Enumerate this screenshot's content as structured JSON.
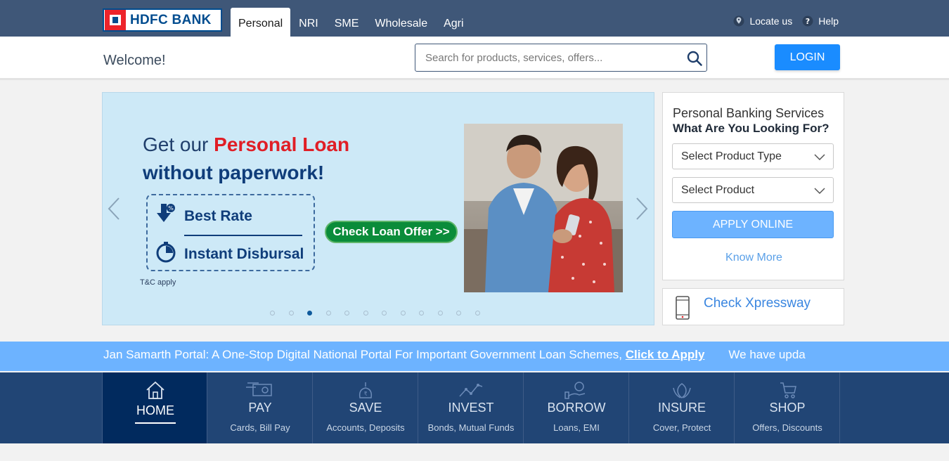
{
  "brand": {
    "logo_text": "HDFC BANK"
  },
  "topnav": {
    "tabs": [
      {
        "label": "Personal",
        "active": true
      },
      {
        "label": "NRI"
      },
      {
        "label": "SME"
      },
      {
        "label": "Wholesale"
      },
      {
        "label": "Agri"
      }
    ],
    "locate_label": "Locate us",
    "help_label": "Help"
  },
  "header": {
    "welcome": "Welcome!",
    "search_placeholder": "Search for products, services, offers...",
    "login_label": "LOGIN"
  },
  "banner": {
    "headline_prefix": "Get our ",
    "headline_highlight": "Personal Loan",
    "headline_line2": "without paperwork!",
    "feature_1": "Best Rate",
    "feature_2": "Instant Disbursal",
    "cta_label": "Check Loan Offer >>",
    "tnc": "T&C apply",
    "slide_count": 12,
    "active_slide": 3
  },
  "services": {
    "title": "Personal Banking Services",
    "subtitle": "What Are You Looking For?",
    "select_type": "Select Product Type",
    "select_product": "Select Product",
    "apply_label": "APPLY ONLINE",
    "know_more": "Know More"
  },
  "xpressway": {
    "label": "Check Xpressway"
  },
  "ticker": {
    "text": "Jan Samarth Portal: A One-Stop Digital National Portal For Important Government Loan Schemes, ",
    "link": "Click to Apply",
    "next_text": "We have upda"
  },
  "bottomnav": {
    "items": [
      {
        "title": "HOME",
        "sub": "",
        "icon": "home-icon",
        "active": true
      },
      {
        "title": "PAY",
        "sub": "Cards, Bill Pay",
        "icon": "pay-icon"
      },
      {
        "title": "SAVE",
        "sub": "Accounts, Deposits",
        "icon": "save-icon"
      },
      {
        "title": "INVEST",
        "sub": "Bonds, Mutual Funds",
        "icon": "invest-icon"
      },
      {
        "title": "BORROW",
        "sub": "Loans, EMI",
        "icon": "borrow-icon"
      },
      {
        "title": "INSURE",
        "sub": "Cover, Protect",
        "icon": "insure-icon"
      },
      {
        "title": "SHOP",
        "sub": "Offers, Discounts",
        "icon": "shop-icon"
      }
    ]
  },
  "colors": {
    "topbar": "#3f5778",
    "accent": "#1a8cff",
    "nav": "#214575",
    "ticker": "#6db3ff",
    "brand_red": "#e01e26"
  }
}
